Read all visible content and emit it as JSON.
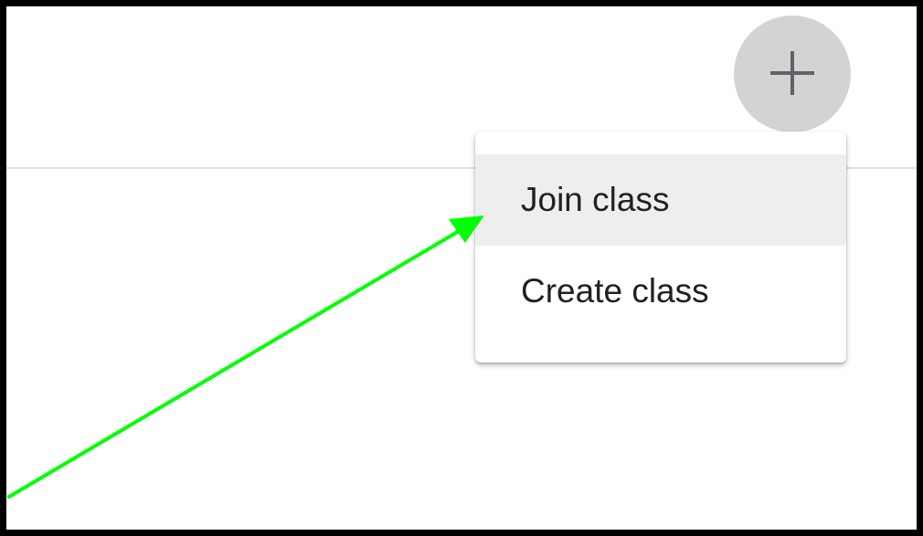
{
  "header": {
    "add_button_icon": "plus-icon"
  },
  "menu": {
    "items": [
      {
        "label": "Join class",
        "highlighted": true
      },
      {
        "label": "Create class",
        "highlighted": false
      }
    ]
  },
  "annotation": {
    "arrow_color": "#00ff00",
    "arrow_target": "Join class"
  },
  "colors": {
    "frame_border": "#000000",
    "add_button_bg": "#d3d3d3",
    "menu_highlight": "#eeeeee"
  }
}
